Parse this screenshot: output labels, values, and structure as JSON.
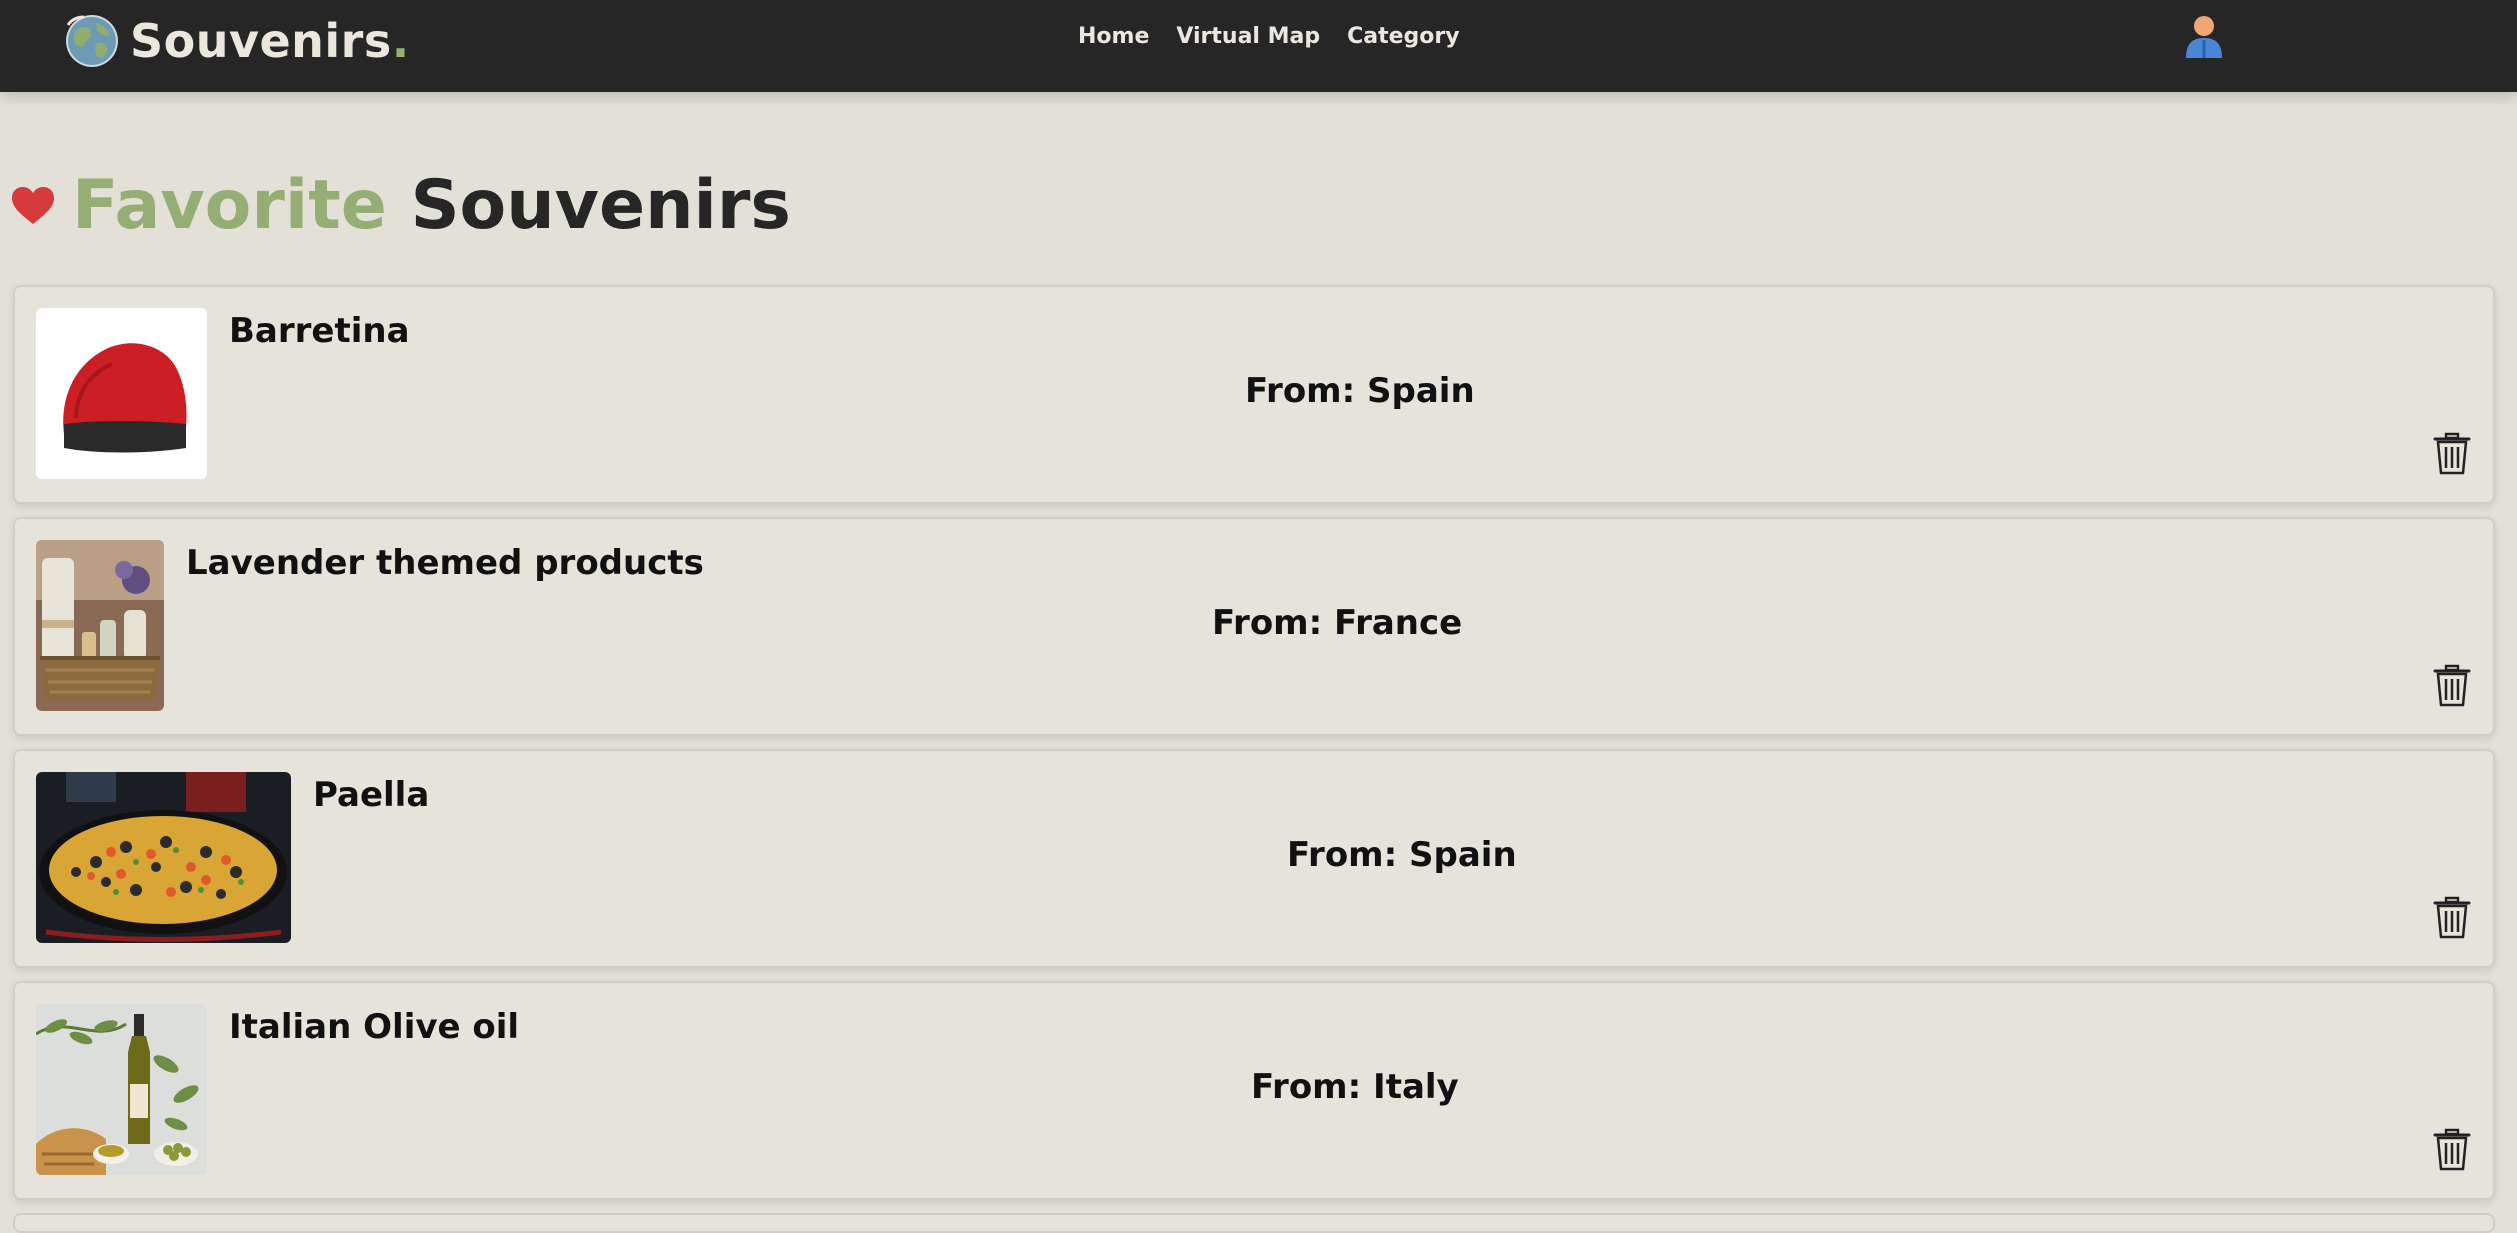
{
  "header": {
    "brand_name": "Souvenirs",
    "brand_dot": ".",
    "nav": [
      {
        "label": "Home"
      },
      {
        "label": "Virtual Map"
      },
      {
        "label": "Category"
      }
    ]
  },
  "page": {
    "title_accent": "Favorite",
    "title_rest": "Souvenirs"
  },
  "favorites": [
    {
      "name": "Barretina",
      "origin": "From: Spain"
    },
    {
      "name": "Lavender themed products",
      "origin": "From: France"
    },
    {
      "name": "Paella",
      "origin": "From: Spain"
    },
    {
      "name": "Italian Olive oil",
      "origin": "From: Italy"
    }
  ],
  "colors": {
    "navbar": "#262626",
    "accent": "#94ae74",
    "background": "#e3e0d7",
    "heart": "#d63a3a"
  },
  "icons": {
    "brand": "globe-icon",
    "user": "user-avatar-icon",
    "heading": "heart-icon",
    "delete": "trash-icon"
  }
}
